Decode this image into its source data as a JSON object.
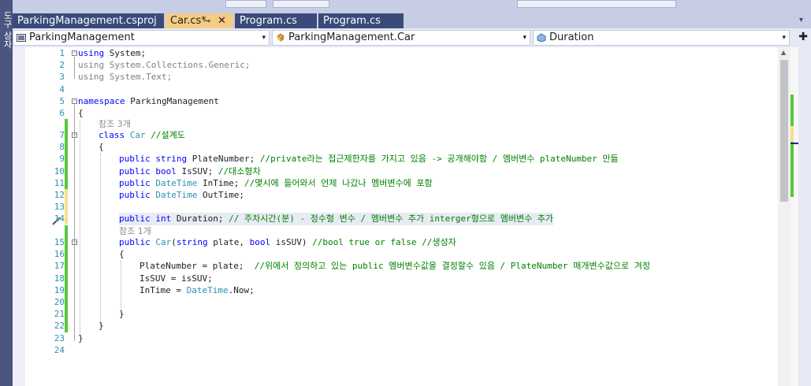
{
  "side_panel": {
    "label": "도구 상자"
  },
  "tabs": [
    {
      "label": "ParkingManagement.csproj",
      "active": false
    },
    {
      "label": "Car.cs*",
      "active": true,
      "pin": "⊸",
      "close": "✕"
    },
    {
      "label": "Program.cs",
      "active": false
    },
    {
      "label": "Program.cs",
      "active": false
    }
  ],
  "tab_overflow": "▾",
  "nav": {
    "project": "ParkingManagement",
    "type": "ParkingManagement.Car",
    "member": "Duration",
    "dropdown_arrow": "▾",
    "split_icon": "split-icon"
  },
  "line_numbers": [
    "1",
    "2",
    "3",
    "4",
    "5",
    "6",
    "7",
    "8",
    "9",
    "10",
    "11",
    "12",
    "13",
    "14",
    "15",
    "16",
    "17",
    "18",
    "19",
    "20",
    "21",
    "22",
    "23",
    "24"
  ],
  "hints": {
    "class_refs": "참조 3개",
    "ctor_refs": "참조 1개"
  },
  "code": {
    "l1_kw": "using",
    "l1_rest": " System;",
    "l2": "using System.Collections.Generic;",
    "l3": "using System.Text;",
    "l5_kw": "namespace",
    "l5_rest": " ParkingManagement",
    "l6": "{",
    "l7_kw": "class",
    "l7_type": "Car",
    "l7_cm": "//설계도",
    "l8": "{",
    "l9_kw1": "public",
    "l9_kw2": "string",
    "l9_name": " PlateNumber;",
    "l9_cm": "//private라는 접근제한자를 가지고 있음 -> 공개해야함 / 멤버변수 plateNumber 만듦",
    "l10_kw1": "public",
    "l10_kw2": "bool",
    "l10_name": " IsSUV;",
    "l10_cm": "//대소형차",
    "l11_kw1": "public",
    "l11_type": "DateTime",
    "l11_name": " InTime;",
    "l11_cm": "//몇시에 들어와서 언제 나갔나 멤버변수에 포함",
    "l12_kw1": "public",
    "l12_type": "DateTime",
    "l12_name": " OutTime;",
    "l14_kw1": "public",
    "l14_kw2": "int",
    "l14_name": " Duration;",
    "l14_cm": "// 주차시간(분) - 정수형 변수 / 멤버변수 추가 interger형으로 멤버변수 추가",
    "l15_kw1": "public",
    "l15_type": "Car",
    "l15_a": "(",
    "l15_kw2": "string",
    "l15_b": " plate, ",
    "l15_kw3": "bool",
    "l15_c": " isSUV)",
    "l15_cm": "//bool true or false //생성자",
    "l16": "{",
    "l17_a": "PlateNumber = plate;",
    "l17_cm": "//위에서 정의하고 있는 public 멤버변수값을 결정할수 있음 / PlateNumber 매개변수값으로 겨정",
    "l18": "IsSUV = isSUV;",
    "l19_a": "InTime = ",
    "l19_type": "DateTime",
    "l19_b": ".Now;",
    "l21": "}",
    "l22": "}",
    "l23": "}"
  },
  "colors": {
    "keyword": "#0000ff",
    "type": "#2b91af",
    "comment": "#008000",
    "line_number": "#2b91af",
    "saved_change": "#57c83c",
    "unsaved_change": "#f5e08a",
    "active_tab": "#f5cc84"
  }
}
